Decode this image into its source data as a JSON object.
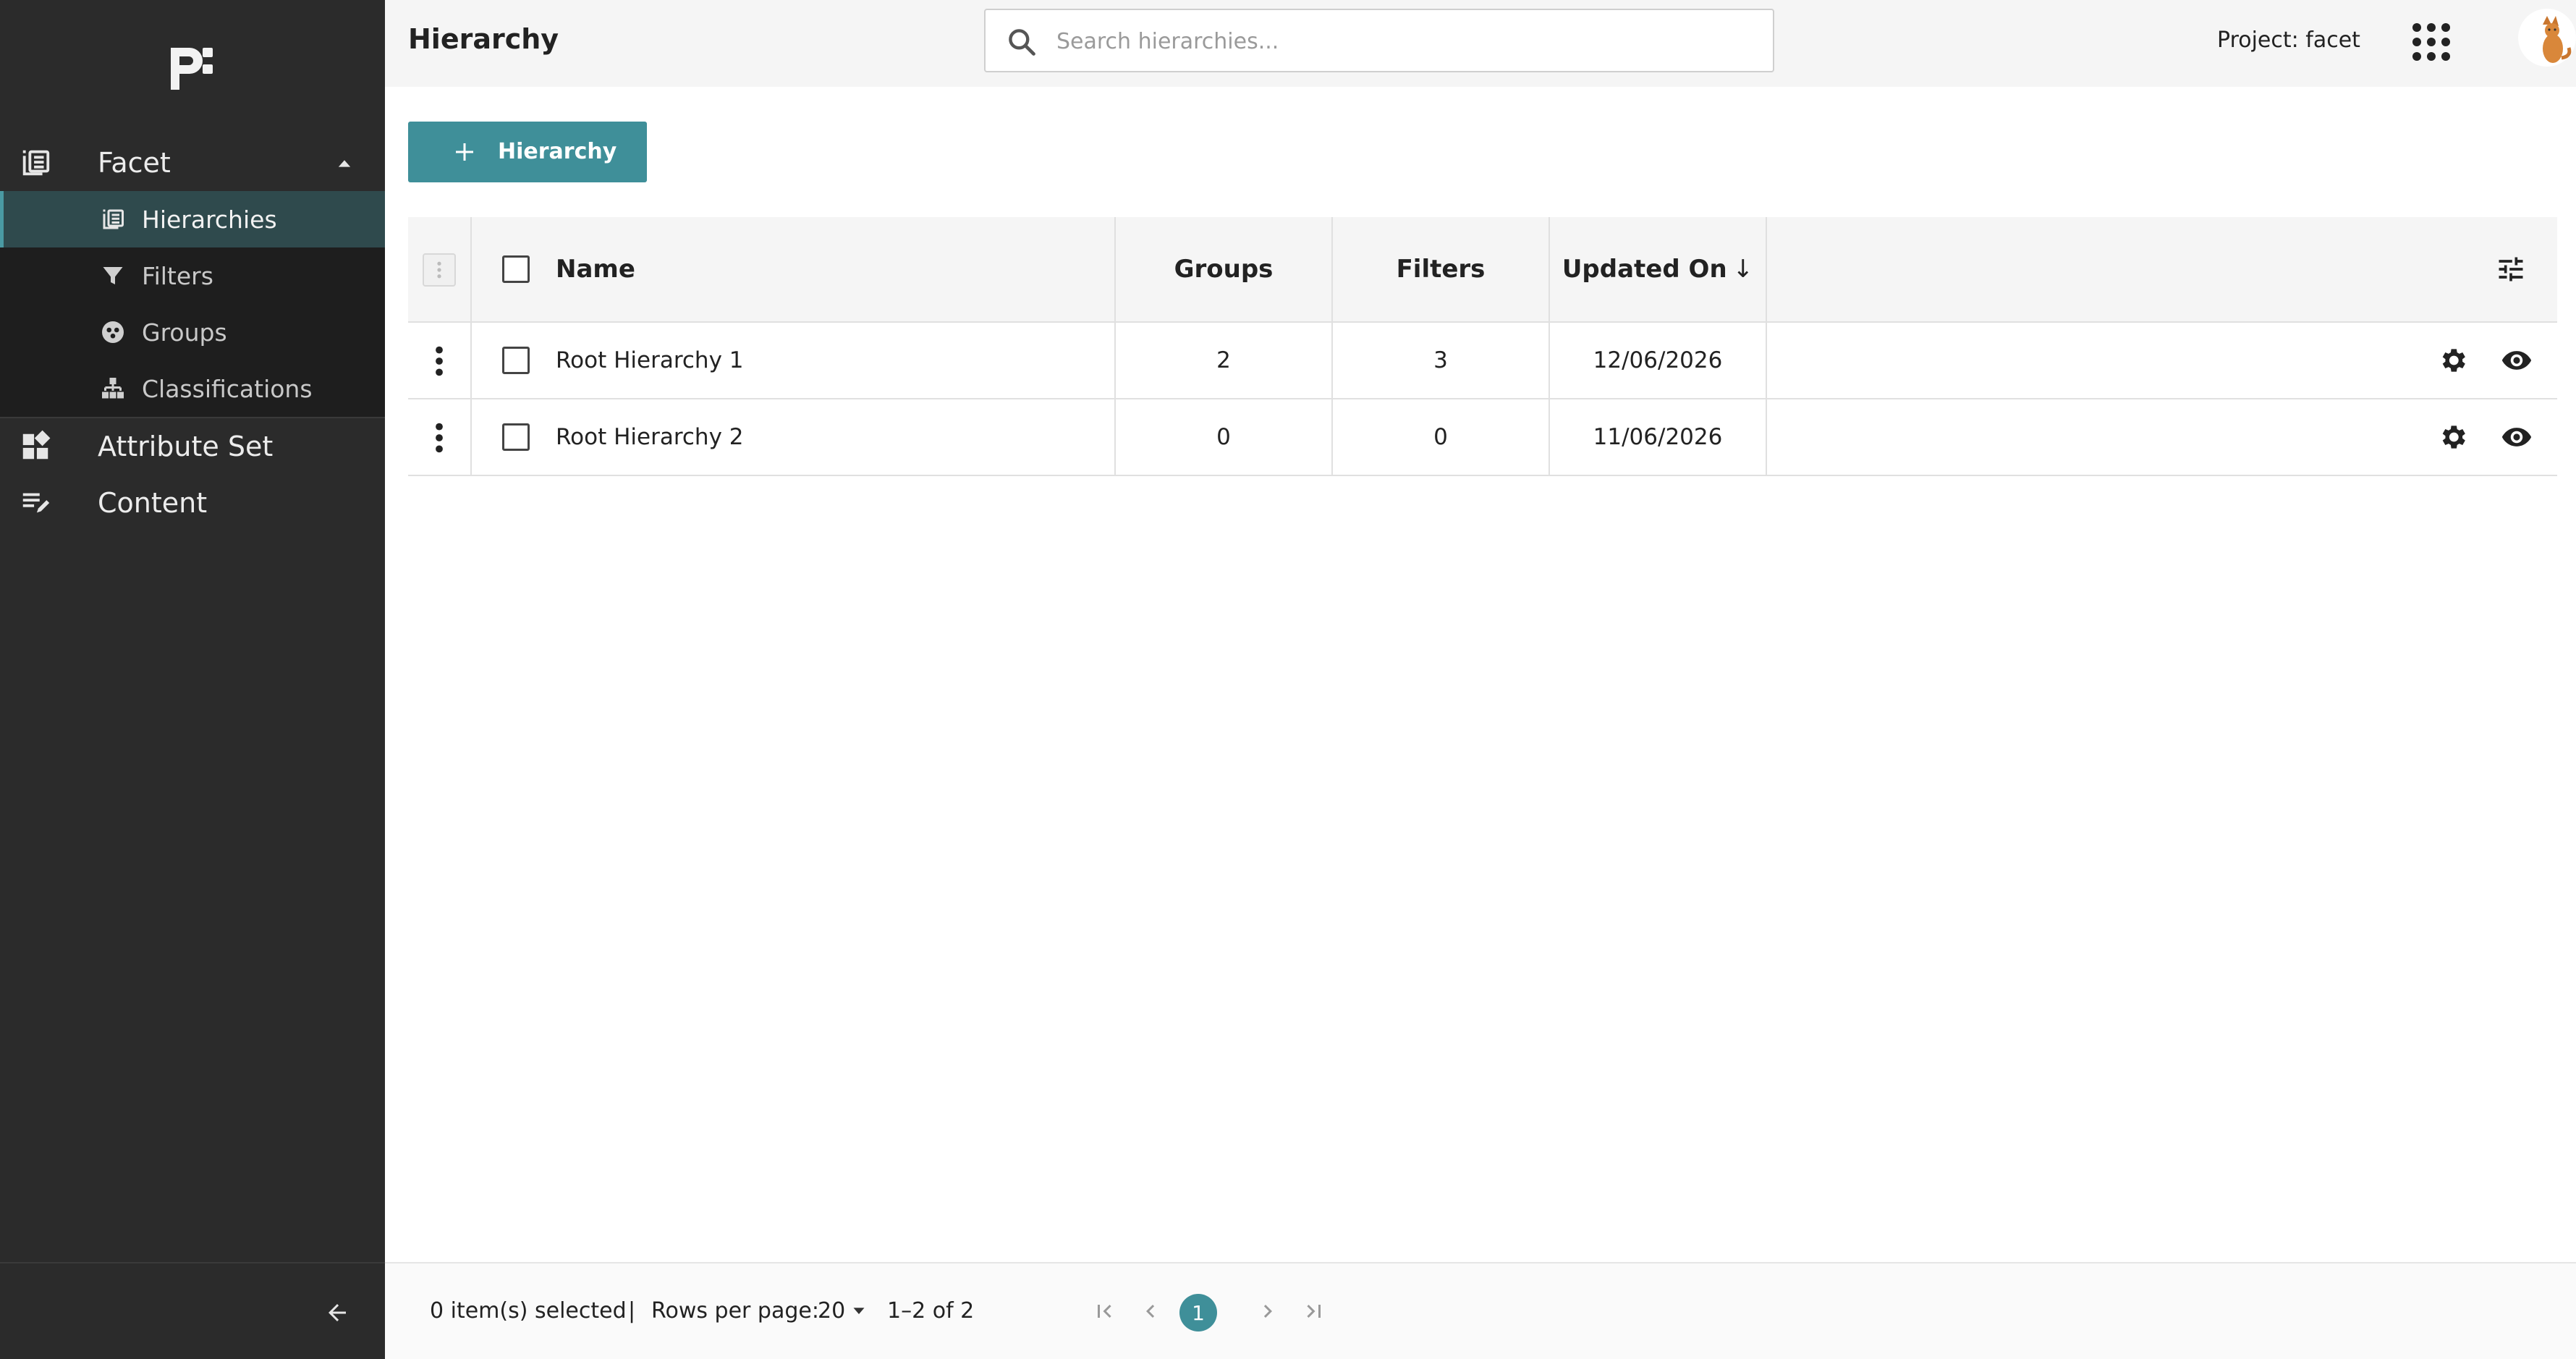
{
  "sidebar": {
    "sections": [
      {
        "label": "Facet",
        "icon": "hierarchy-list-icon",
        "expanded": true,
        "items": [
          {
            "label": "Hierarchies",
            "icon": "hierarchy-list-icon",
            "active": true
          },
          {
            "label": "Filters",
            "icon": "filter-icon"
          },
          {
            "label": "Groups",
            "icon": "groups-icon"
          },
          {
            "label": "Classifications",
            "icon": "classification-tree-icon"
          }
        ]
      },
      {
        "label": "Attribute Set",
        "icon": "dashboard-icon"
      },
      {
        "label": "Content",
        "icon": "edit-list-icon"
      }
    ]
  },
  "header": {
    "title": "Hierarchy",
    "search_placeholder": "Search hierarchies...",
    "project": "Project: facet"
  },
  "toolbar": {
    "add_label": "Hierarchy"
  },
  "table": {
    "columns": [
      "Name",
      "Groups",
      "Filters",
      "Updated On"
    ],
    "sort_indicator": "↓",
    "rows": [
      {
        "name": "Root Hierarchy 1",
        "groups": "2",
        "filters": "3",
        "updated": "12/06/2026"
      },
      {
        "name": "Root Hierarchy 2",
        "groups": "0",
        "filters": "0",
        "updated": "11/06/2026"
      }
    ]
  },
  "footer": {
    "selected": "0 item(s) selected",
    "divider": "|",
    "rows_per_page_label": "Rows per page:",
    "rows_per_page": "20",
    "range": "1–2 of 2",
    "current_page": "1"
  },
  "colors": {
    "accent": "#3f8f99",
    "sidebar_bg": "#2b2b2b",
    "active_bg": "#2f4a4d"
  }
}
